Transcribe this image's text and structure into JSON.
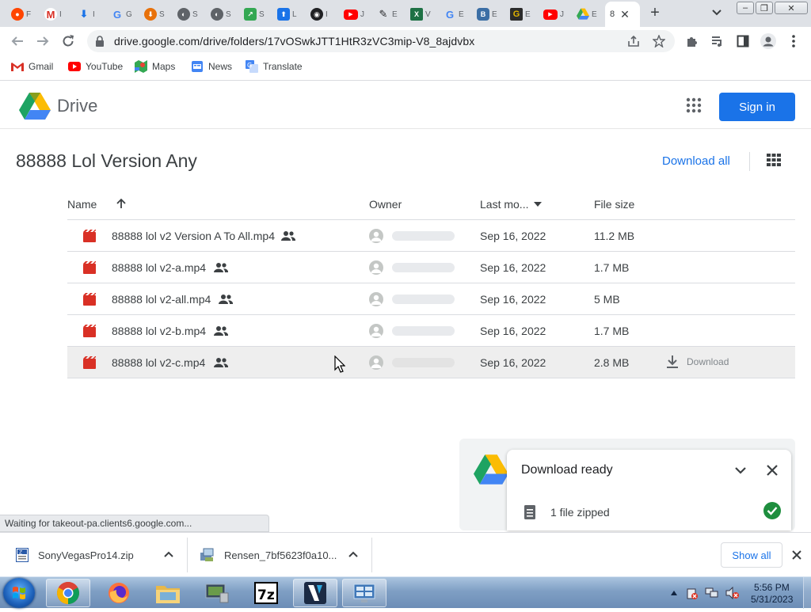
{
  "browser": {
    "tabs": [
      {
        "letter": "F",
        "icon": "reddit-icon",
        "color": "#ff4500"
      },
      {
        "letter": "I",
        "icon": "gmail-icon",
        "color": "#d93025"
      },
      {
        "letter": "I",
        "icon": "download-icon",
        "color": "#1a73e8"
      },
      {
        "letter": "G",
        "icon": "google-icon",
        "color": "#4285f4"
      },
      {
        "letter": "S",
        "icon": "download-orange-icon",
        "color": "#e8710a"
      },
      {
        "letter": "S",
        "icon": "globe-icon",
        "color": "#5f6368"
      },
      {
        "letter": "S",
        "icon": "globe-icon",
        "color": "#5f6368"
      },
      {
        "letter": "S",
        "icon": "share-green-icon",
        "color": "#34a853"
      },
      {
        "letter": "L",
        "icon": "upload-icon",
        "color": "#1a73e8"
      },
      {
        "letter": "I",
        "icon": "github-icon",
        "color": "#202124"
      },
      {
        "letter": "J",
        "icon": "youtube-icon",
        "color": "#ff0000"
      },
      {
        "letter": "E",
        "icon": "puzzle-icon",
        "color": "#202124"
      },
      {
        "letter": "V",
        "icon": "excel-icon",
        "color": "#1e7145"
      },
      {
        "letter": "E",
        "icon": "google-icon",
        "color": "#4285f4"
      },
      {
        "letter": "E",
        "icon": "shield-icon",
        "color": "#3b6ea5"
      },
      {
        "letter": "E",
        "icon": "g-square-icon",
        "color": "#8a6d00"
      },
      {
        "letter": "J",
        "icon": "youtube-icon",
        "color": "#ff0000"
      },
      {
        "letter": "E",
        "icon": "drive-icon",
        "color": "#fbbc04"
      }
    ],
    "active_tab": {
      "letter": "8",
      "close": "✕"
    },
    "new_tab": "+",
    "url": "drive.google.com/drive/folders/17vOSwkJTT1HtR3zVC3mip-V8_8ajdvbx",
    "window_controls": {
      "minimize": "–",
      "restore": "❐",
      "close": "✕"
    }
  },
  "bookmarks": [
    {
      "label": "Gmail",
      "icon": "gmail-icon"
    },
    {
      "label": "YouTube",
      "icon": "youtube-icon"
    },
    {
      "label": "Maps",
      "icon": "maps-icon"
    },
    {
      "label": "News",
      "icon": "news-icon"
    },
    {
      "label": "Translate",
      "icon": "translate-icon"
    }
  ],
  "drive": {
    "app_name": "Drive",
    "sign_in": "Sign in",
    "folder_title": "88888 Lol Version Any",
    "download_all": "Download all",
    "columns": {
      "name": "Name",
      "owner": "Owner",
      "last_modified": "Last mo...",
      "file_size": "File size"
    },
    "files": [
      {
        "name": "88888 lol v2 Version A To All.mp4",
        "date": "Sep 16, 2022",
        "size": "11.2 MB"
      },
      {
        "name": "88888 lol v2-a.mp4",
        "date": "Sep 16, 2022",
        "size": "1.7 MB"
      },
      {
        "name": "88888 lol v2-all.mp4",
        "date": "Sep 16, 2022",
        "size": "5 MB"
      },
      {
        "name": "88888 lol v2-b.mp4",
        "date": "Sep 16, 2022",
        "size": "1.7 MB"
      },
      {
        "name": "88888 lol v2-c.mp4",
        "date": "Sep 16, 2022",
        "size": "2.8 MB"
      }
    ],
    "row_download_label": "Download"
  },
  "toast": {
    "title": "Download ready",
    "item_label": "1 file zipped"
  },
  "status_text": "Waiting for takeout-pa.clients6.google.com...",
  "downloads": {
    "items": [
      {
        "name": "SonyVegasPro14.zip"
      },
      {
        "name": "Rensen_7bf5623f0a10..."
      }
    ],
    "show_all": "Show all"
  },
  "taskbar": {
    "time": "5:56 PM",
    "date": "5/31/2023"
  },
  "colors": {
    "accent": "#1a73e8",
    "video_icon": "#d93025",
    "success": "#1e8e3e"
  }
}
